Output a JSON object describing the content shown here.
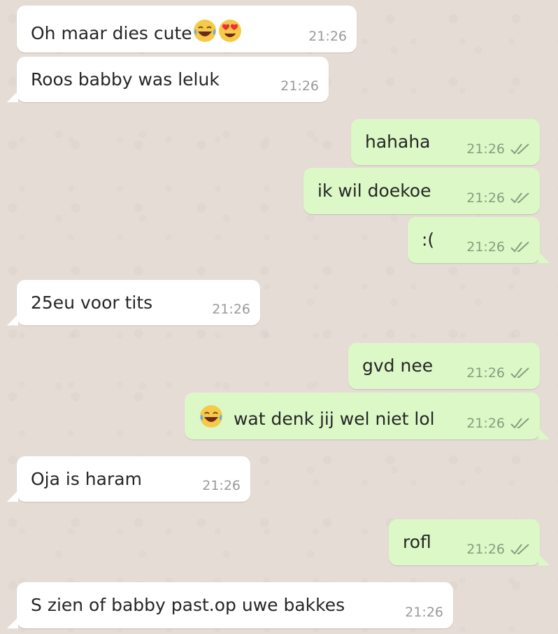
{
  "chat": {
    "messages": [
      {
        "dir": "in",
        "text": "Oh maar dies cute",
        "emojis_after": [
          "laughing-crying-emoji",
          "heart-eyes-emoji"
        ],
        "time": "21:26"
      },
      {
        "dir": "in",
        "text": "Roos babby was leluk",
        "time": "21:26"
      },
      {
        "dir": "out",
        "text": "hahaha",
        "time": "21:26",
        "status": "read-double-check"
      },
      {
        "dir": "out",
        "text": "ik wil doekoe",
        "time": "21:26",
        "status": "read-double-check"
      },
      {
        "dir": "out",
        "text": ":(",
        "time": "21:26",
        "status": "read-double-check"
      },
      {
        "dir": "in",
        "text": "25eu voor tits",
        "time": "21:26"
      },
      {
        "dir": "out",
        "text": "gvd nee",
        "time": "21:26",
        "status": "read-double-check"
      },
      {
        "dir": "out",
        "text": "wat denk jij wel niet lol",
        "emojis_before": [
          "laughing-crying-emoji"
        ],
        "time": "21:26",
        "status": "read-double-check"
      },
      {
        "dir": "in",
        "text": "Oja is haram",
        "time": "21:26"
      },
      {
        "dir": "out",
        "text": "rofl",
        "time": "21:26",
        "status": "read-double-check"
      },
      {
        "dir": "in",
        "text": "S zien of babby past.op uwe bakkes",
        "time": "21:26"
      }
    ]
  },
  "colors": {
    "background": "#e5ddd5",
    "incoming_bubble": "#ffffff",
    "outgoing_bubble": "#dcf8c6",
    "time_text": "#999999",
    "tick_color": "#8a9c7f"
  }
}
